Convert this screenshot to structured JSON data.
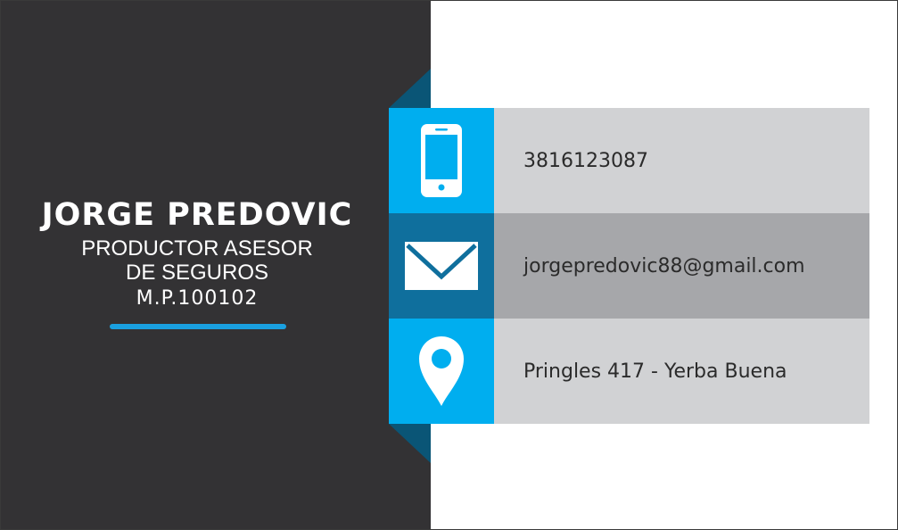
{
  "card": {
    "name": "JORGE PREDOVIC",
    "role_line1": "PRODUCTOR ASESOR",
    "role_line2": "DE SEGUROS",
    "license": "M.P.100102"
  },
  "contacts": {
    "phone": {
      "icon": "phone-icon",
      "value": "3816123087"
    },
    "email": {
      "icon": "envelope-icon",
      "value": "jorgepredovic88@gmail.com"
    },
    "address": {
      "icon": "location-pin-icon",
      "value": "Pringles 417 - Yerba Buena"
    }
  },
  "colors": {
    "dark_panel": "#333234",
    "accent_blue": "#00aeef",
    "dark_blue": "#0f6f9d",
    "light_gray": "#d1d2d4",
    "mid_gray": "#a6a7aa"
  }
}
